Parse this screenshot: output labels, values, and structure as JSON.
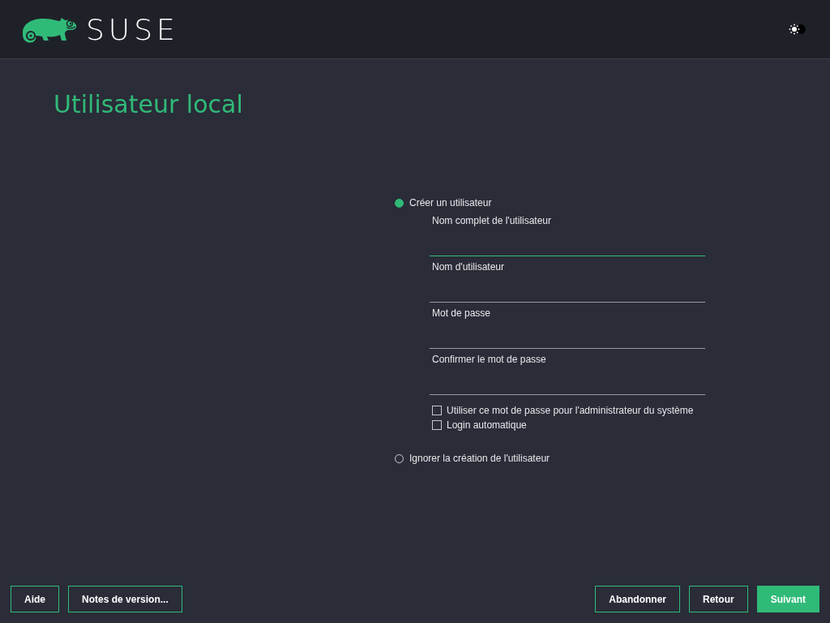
{
  "header": {
    "logo_text": "SUSE"
  },
  "title": "Utilisateur local",
  "options": [
    {
      "label": "Créer un utilisateur",
      "selected": true,
      "fields": [
        {
          "label": "Nom complet de l'utilisateur",
          "focused": true
        },
        {
          "label": "Nom d'utilisateur",
          "focused": false
        },
        {
          "label": "Mot de passe",
          "focused": false
        },
        {
          "label": "Confirmer le mot de passe",
          "focused": false
        }
      ],
      "checkboxes": [
        {
          "label": "Utiliser ce mot de passe pour l'administrateur du système",
          "checked": false
        },
        {
          "label": "Login automatique",
          "checked": false
        }
      ]
    },
    {
      "label": "Ignorer la création de l'utilisateur",
      "selected": false
    }
  ],
  "buttons_left": [
    {
      "label": "Aide",
      "primary": false
    },
    {
      "label": "Notes de version...",
      "primary": false
    }
  ],
  "buttons_right": [
    {
      "label": "Abandonner",
      "primary": false
    },
    {
      "label": "Retour",
      "primary": false
    },
    {
      "label": "Suivant",
      "primary": true
    }
  ]
}
